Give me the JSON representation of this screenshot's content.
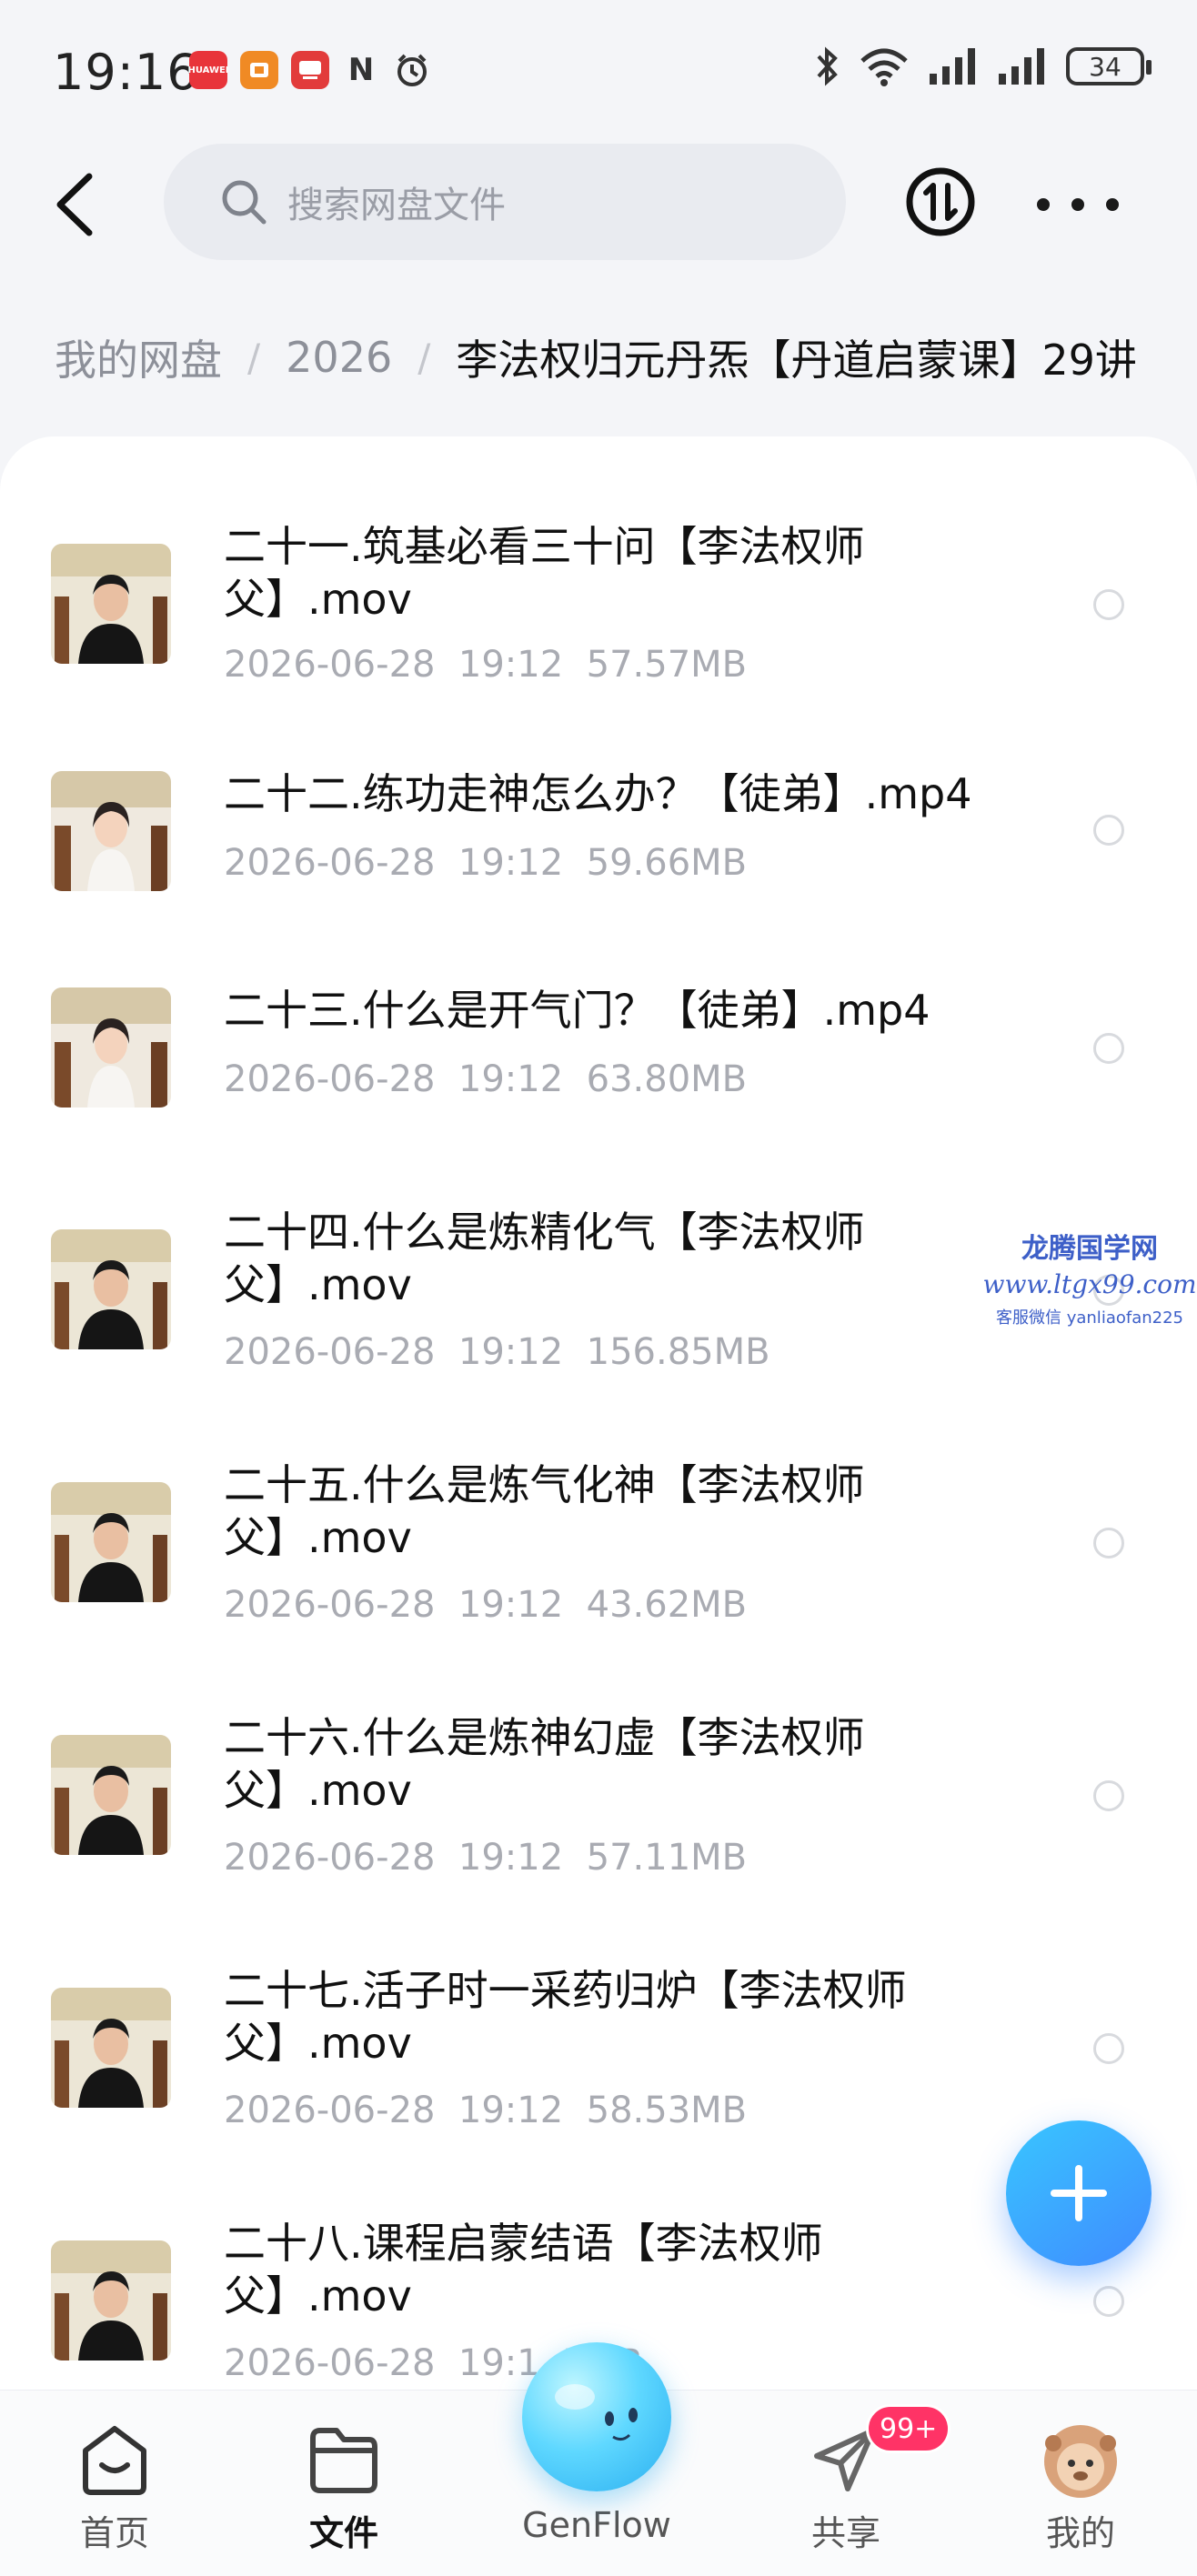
{
  "status_bar": {
    "time": "19:16",
    "apps": [
      {
        "icon": "huawei-app-icon",
        "label": "HUAWEI",
        "color": "#e8343a"
      },
      {
        "icon": "store-app-icon",
        "label": "",
        "color": "#f08a24"
      },
      {
        "icon": "tv-app-icon",
        "label": "",
        "color": "#e23b3b"
      },
      {
        "icon": "nfc-icon",
        "label": "N",
        "color": "#333333"
      },
      {
        "icon": "alarm-icon",
        "label": "",
        "color": "#333333"
      }
    ],
    "battery": "34"
  },
  "header": {
    "search_placeholder": "搜索网盘文件"
  },
  "breadcrumb": {
    "items": [
      "我的网盘",
      "2026"
    ],
    "current": "李法权归元丹炁【丹道启蒙课】29讲"
  },
  "files": [
    {
      "name": "二十一.筑基必看三十问【李法权师父】.mov",
      "date": "2026-06-28",
      "time": "19:12",
      "size": "57.57MB",
      "thumb": "man"
    },
    {
      "name": "二十二.练功走神怎么办？【徒弟】.mp4",
      "date": "2026-06-28",
      "time": "19:12",
      "size": "59.66MB",
      "thumb": "woman"
    },
    {
      "name": "二十三.什么是开气门？【徒弟】.mp4",
      "date": "2026-06-28",
      "time": "19:12",
      "size": "63.80MB",
      "thumb": "woman"
    },
    {
      "name": "二十四.什么是炼精化气【李法权师父】.mov",
      "date": "2026-06-28",
      "time": "19:12",
      "size": "156.85MB",
      "thumb": "man"
    },
    {
      "name": "二十五.什么是炼气化神【李法权师父】.mov",
      "date": "2026-06-28",
      "time": "19:12",
      "size": "43.62MB",
      "thumb": "man"
    },
    {
      "name": "二十六.什么是炼神幻虚【李法权师父】.mov",
      "date": "2026-06-28",
      "time": "19:12",
      "size": "57.11MB",
      "thumb": "man"
    },
    {
      "name": "二十七.活子时一采药归炉【李法权师父】.mov",
      "date": "2026-06-28",
      "time": "19:12",
      "size": "58.53MB",
      "thumb": "man"
    },
    {
      "name": "二十八.课程启蒙结语【李法权师父】.mov",
      "date": "2026-06-28",
      "time": "19:1",
      "size": "7MB",
      "thumb": "man"
    }
  ],
  "watermark": {
    "line1": "龙腾国学网",
    "line2": "www.ltgx99.com",
    "line3": "客服微信 yanliaofan225"
  },
  "bottom_nav": {
    "items": [
      {
        "label": "首页",
        "icon": "home-icon",
        "active": false
      },
      {
        "label": "文件",
        "icon": "folder-icon",
        "active": true
      },
      {
        "label": "GenFlow",
        "icon": "genflow-icon",
        "active": false
      },
      {
        "label": "共享",
        "icon": "share-icon",
        "active": false
      },
      {
        "label": "我的",
        "icon": "avatar-icon",
        "active": false
      }
    ],
    "share_badge": "99+"
  },
  "colors": {
    "accent": "#3f8bff",
    "badge": "#ff3366",
    "meta_text": "#a9abb2"
  }
}
